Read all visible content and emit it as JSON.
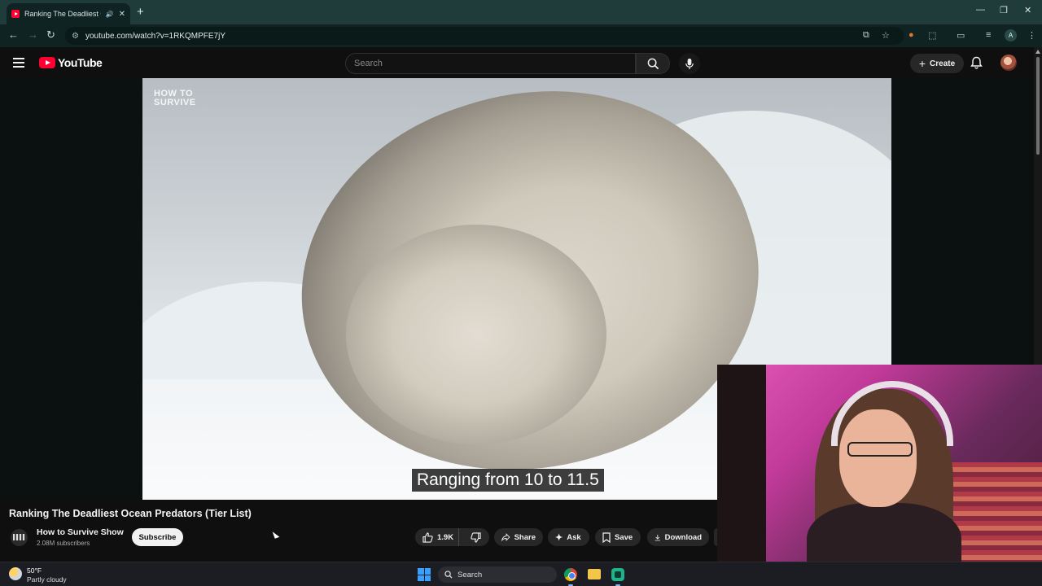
{
  "browser": {
    "tab_title": "Ranking The Deadliest Oce",
    "tab_sound_icon": "speaker-icon",
    "tab_close": "✕",
    "new_tab": "+",
    "url": "youtube.com/watch?v=1RKQMPFE7jY",
    "profile_initial": "A",
    "window_controls": [
      "—",
      "❐",
      "✕"
    ]
  },
  "youtube": {
    "logo_text": "YouTube",
    "search_placeholder": "Search",
    "create_label": "Create",
    "video": {
      "watermark_line1": "HOW TO",
      "watermark_line2": "SURVIVE",
      "caption": "Ranging from 10 to 11.5"
    },
    "title": "Ranking The Deadliest Ocean Predators (Tier List)",
    "channel": {
      "name": "How to Survive Show",
      "subscribers": "2.08M subscribers"
    },
    "subscribe_label": "Subscribe",
    "actions": {
      "likes": "1.9K",
      "share": "Share",
      "ask": "Ask",
      "save": "Save",
      "download": "Download"
    }
  },
  "taskbar": {
    "temperature": "50°F",
    "weather": "Partly cloudy",
    "search_label": "Search"
  },
  "colors": {
    "accent_red": "#ff0033",
    "chrome_frame": "#1f3b3a",
    "background": "#0f0f0f"
  }
}
